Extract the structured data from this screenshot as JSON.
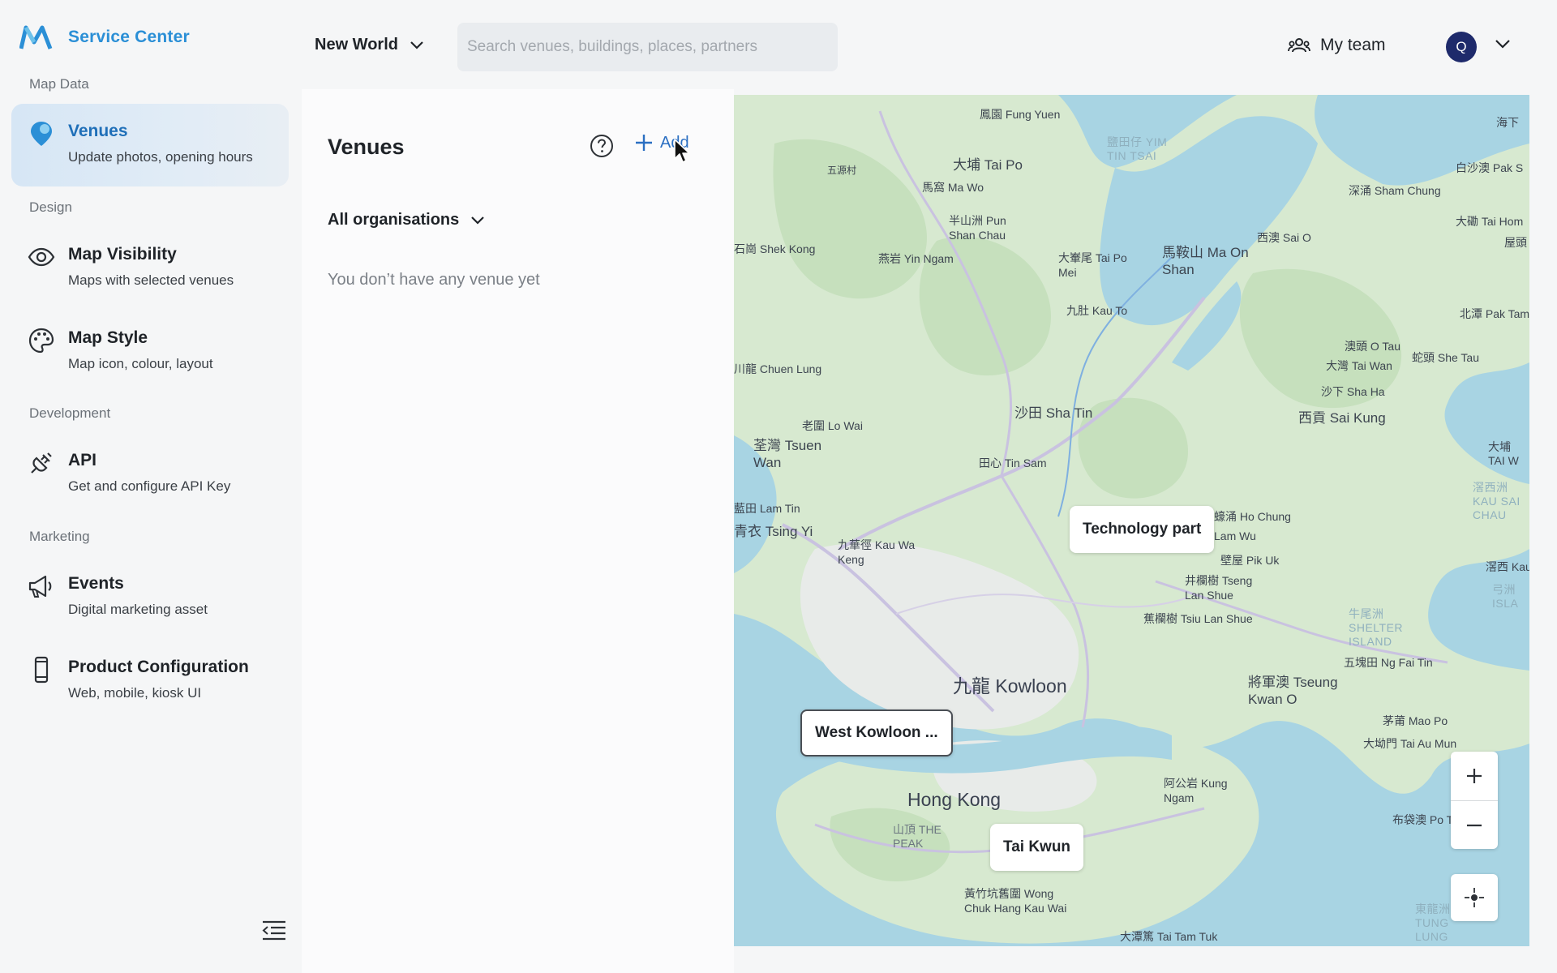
{
  "header": {
    "logo_text": "Service Center",
    "world": "New World",
    "search_placeholder": "Search venues, buildings, places, partners",
    "team_label": "My team",
    "avatar_initial": "Q"
  },
  "sidebar": {
    "sections": {
      "map_data": "Map Data",
      "design": "Design",
      "development": "Development",
      "marketing": "Marketing"
    },
    "items": [
      {
        "title": "Venues",
        "subtitle": "Update photos, opening hours",
        "icon": "map-pin-icon",
        "active": true
      },
      {
        "title": "Map Visibility",
        "subtitle": "Maps with selected venues",
        "icon": "eye-icon"
      },
      {
        "title": "Map Style",
        "subtitle": "Map icon, colour, layout",
        "icon": "palette-icon"
      },
      {
        "title": "API",
        "subtitle": "Get and configure API Key",
        "icon": "plug-icon"
      },
      {
        "title": "Events",
        "subtitle": "Digital marketing asset",
        "icon": "megaphone-icon"
      },
      {
        "title": "Product Configuration",
        "subtitle": "Web, mobile, kiosk UI",
        "icon": "mobile-icon"
      }
    ]
  },
  "panel": {
    "title": "Venues",
    "add_label": "Add",
    "org_filter": "All organisations",
    "empty_text": "You don’t have any venue yet"
  },
  "map": {
    "labels": {
      "fung_yuen": "鳳園 Fung Yuen",
      "tai_po": "大埔 Tai Po",
      "ng_tung_chai": "五源村",
      "ma_wo": "馬窩 Ma Wo",
      "pun_shan_chau": "半山洲 Pun Shan Chau",
      "yim_tin_tsai": "鹽田仔 YIM TIN TSAI",
      "hoi_ha": "海下",
      "pak_sha_o": "白沙澳 Pak S",
      "sham_chung": "深涌 Sham Chung",
      "tai_hom": "大磡 Tai Hom",
      "sai_o": "西澳 Sai O",
      "uk_tau": "屋頭",
      "shek_kong": "石崗 Shek Kong",
      "yin_ngam": "燕岩 Yin Ngam",
      "tai_po_mei": "大輋尾 Tai Po Mei",
      "ma_on_shan": "馬鞍山 Ma On Shan",
      "kau_to": "九肚 Kau To",
      "pak_tam": "北潭 Pak Tam",
      "o_tau": "澳頭 O Tau",
      "she_tau": "蛇頭 She Tau",
      "tai_wan": "大灣 Tai Wan",
      "sha_ha": "沙下 Sha Ha",
      "sai_kung": "西貢 Sai Kung",
      "chuen_lung": "川龍 Chuen Lung",
      "lo_wai": "老圍 Lo Wai",
      "sha_tin": "沙田 Sha Tin",
      "tsuen_wan": "荃灣 Tsuen Wan",
      "tin_sam": "田心 Tin Sam",
      "tai_wai": "大埔 TAI W",
      "lam_tin": "藍田 Lam Tin",
      "tsing_yi": "青衣 Tsing Yi",
      "kau_wa_keng": "九華徑 Kau Wa Keng",
      "ho_chung": "蠔涌 Ho Chung",
      "lam_wu": "Lam Wu",
      "pik_uk": "壁屋 Pik Uk",
      "tseng_lan_shue": "井欄樹 Tseng Lan Shue",
      "tsiu_lan_shue": "蕉欄樹 Tsiu Lan Shue",
      "kau_sai_chau": "滘西洲 KAU SAI CHAU",
      "kau": "滘西 Kau",
      "shelter_island": "牛尾洲 SHELTER ISLAND",
      "ng_fai_tin": "五塊田 Ng Fai Tin",
      "kowloon": "九龍 Kowloon",
      "tseung_kwan_o": "將軍澳 Tseung Kwan O",
      "mao_po": "茅莆 Mao Po",
      "tai_au_mun": "大坳門 Tai Au Mun",
      "kung_ngam": "阿公岩 Kung Ngam",
      "hong_kong": "Hong Kong",
      "the_peak": "山頂 THE PEAK",
      "po_toi": "布袋澳 Po To",
      "wong_chuk_hang": "黃竹坑舊圍 Wong Chuk Hang Kau Wai",
      "tung_lung_chau": "東龍洲 TUNG LUNG CHAU",
      "tai_tam_tuk": "大潭篤 Tai Tam Tuk",
      "lung_islands": "弓洲 ISLA"
    },
    "markers": {
      "technology": "Technology part",
      "west_kowloon": "West Kowloon ...",
      "tai_kwun": "Tai Kwun"
    }
  },
  "colors": {
    "accent": "#1f6fb8",
    "logo": "#2b8fd6",
    "avatar_bg": "#1e2a6b",
    "land": "#d9ead4",
    "sea": "#a8d4e3"
  }
}
